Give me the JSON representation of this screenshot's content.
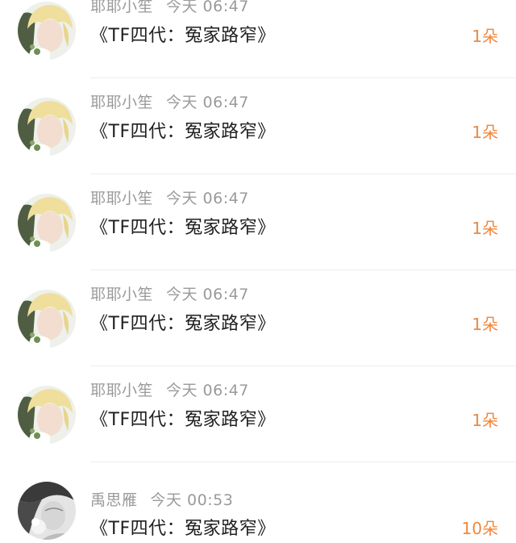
{
  "records": [
    {
      "user": "耶耶小笙",
      "time": "今天 06:47",
      "title": "《TF四代：冤家路窄》",
      "gift": "1朵",
      "avatar_icon": "user-avatar-blonde-icon"
    },
    {
      "user": "耶耶小笙",
      "time": "今天 06:47",
      "title": "《TF四代：冤家路窄》",
      "gift": "1朵",
      "avatar_icon": "user-avatar-blonde-icon"
    },
    {
      "user": "耶耶小笙",
      "time": "今天 06:47",
      "title": "《TF四代：冤家路窄》",
      "gift": "1朵",
      "avatar_icon": "user-avatar-blonde-icon"
    },
    {
      "user": "耶耶小笙",
      "time": "今天 06:47",
      "title": "《TF四代：冤家路窄》",
      "gift": "1朵",
      "avatar_icon": "user-avatar-blonde-icon"
    },
    {
      "user": "耶耶小笙",
      "time": "今天 06:47",
      "title": "《TF四代：冤家路窄》",
      "gift": "1朵",
      "avatar_icon": "user-avatar-blonde-icon"
    },
    {
      "user": "禹思雁",
      "time": "今天 00:53",
      "title": "《TF四代：冤家路窄》",
      "gift": "10朵",
      "avatar_icon": "user-avatar-monochrome-icon"
    }
  ],
  "colors": {
    "gift_accent": "#f0873c",
    "meta_text": "#9a9a9a",
    "title_text": "#1f1f1f",
    "divider": "#ededed"
  }
}
